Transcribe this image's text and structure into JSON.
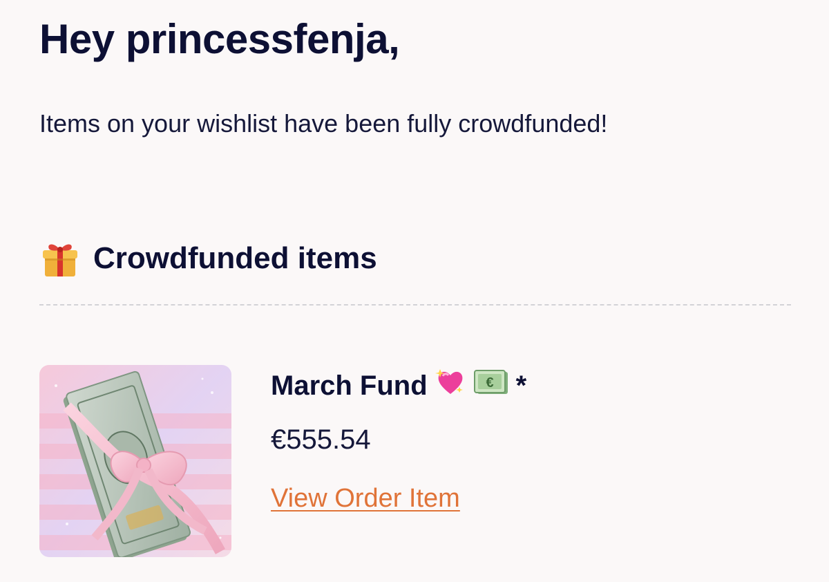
{
  "email": {
    "greeting": "Hey princessfenja,",
    "intro": "Items on your wishlist have been fully crowdfunded!"
  },
  "section": {
    "icon": "gift-icon",
    "title": "Crowdfunded items"
  },
  "items": [
    {
      "image": "money-bundle-with-pink-ribbon",
      "name": "March Fund",
      "name_suffix": "*",
      "name_icons": [
        "sparkling-heart-icon",
        "euro-banknote-icon"
      ],
      "price": "€555.54",
      "link_label": "View Order Item"
    }
  ],
  "colors": {
    "background": "#fbf8f8",
    "text": "#0d1034",
    "link": "#e07338",
    "divider": "#d2d2d6"
  }
}
